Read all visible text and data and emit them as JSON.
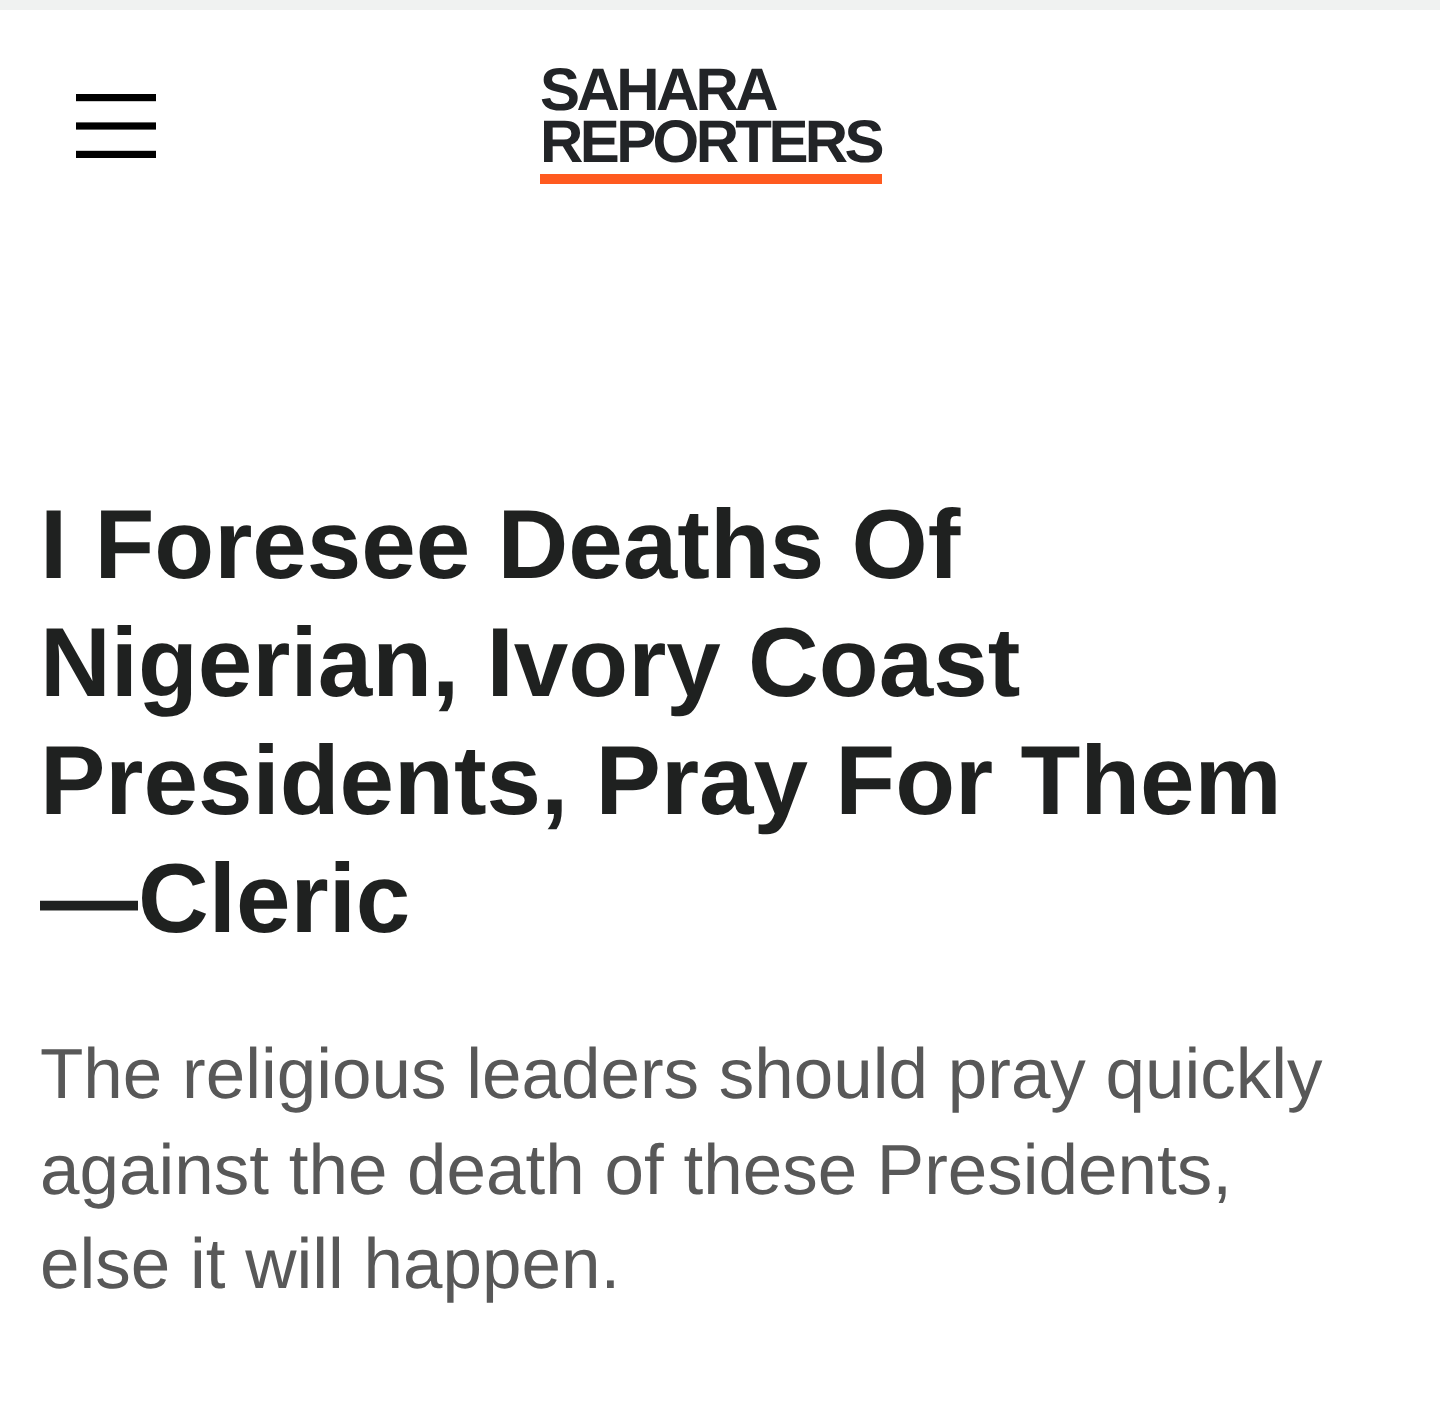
{
  "header": {
    "logo": {
      "lines": [
        "SAHARA",
        "REPORTERS"
      ]
    }
  },
  "article": {
    "headline": "I Foresee Deaths Of Nigerian, Ivory Coast Presidents, Pray For Them —Cleric",
    "summary": "The religious leaders should pray quickly against the death of these Presidents, else it will happen."
  }
}
